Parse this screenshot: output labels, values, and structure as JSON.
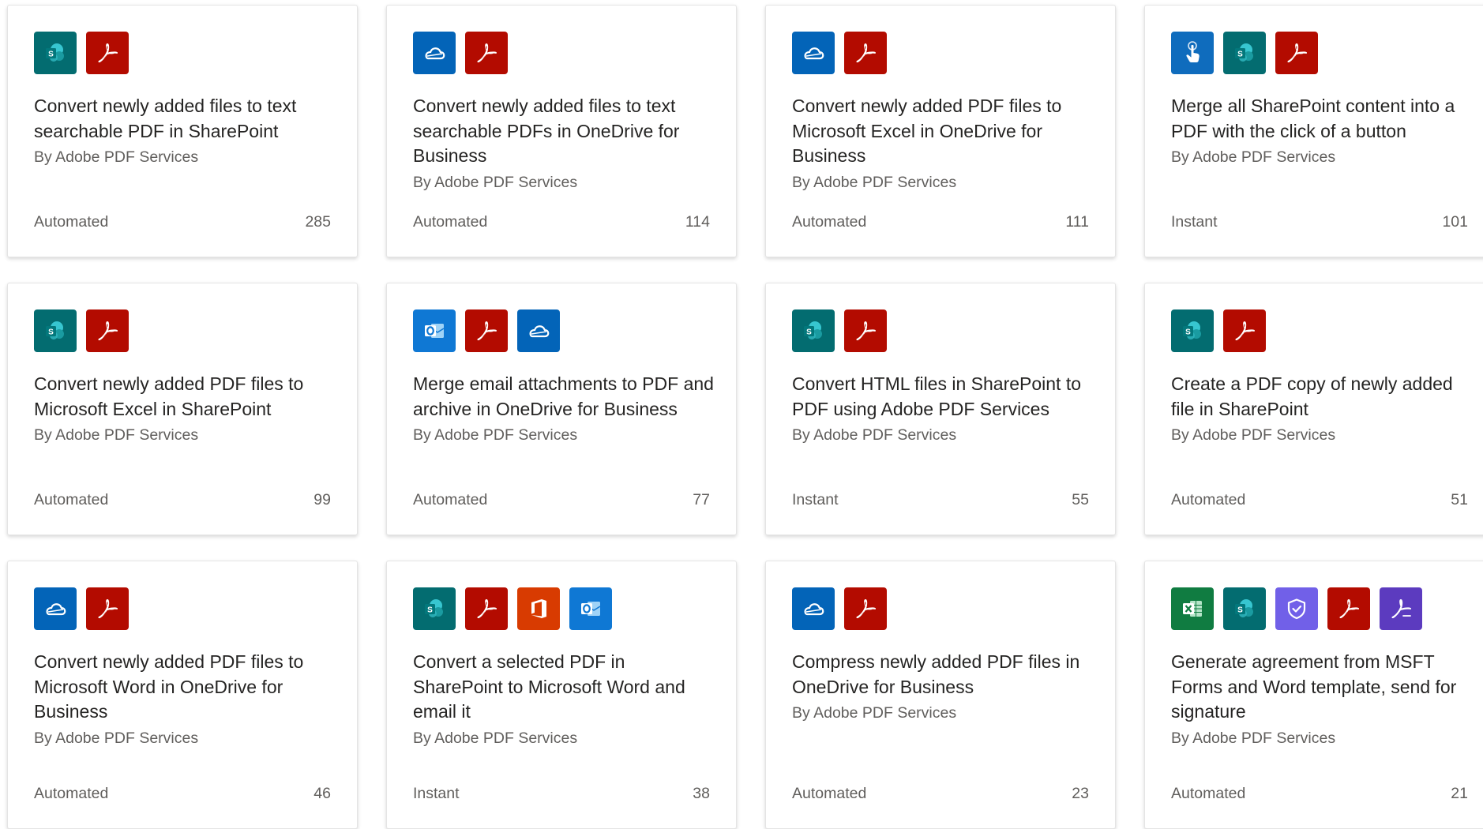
{
  "icon_colors": {
    "sharepoint": "#036c70",
    "acrobat": "#b30b00",
    "onedrive": "#0364b8",
    "button": "#0f6cbd",
    "outlook": "#0f78d4",
    "office": "#d83b01",
    "excel": "#107c41",
    "forms": "#7160e8",
    "acrobat_sign": "#5c3bbf"
  },
  "cards": [
    {
      "icons": [
        "sharepoint-icon",
        "acrobat-icon"
      ],
      "title": "Convert newly added files to text searchable PDF in SharePoint",
      "author": "By Adobe PDF Services",
      "type": "Automated",
      "count": "285"
    },
    {
      "icons": [
        "onedrive-icon",
        "acrobat-icon"
      ],
      "title": "Convert newly added files to text searchable PDFs in OneDrive for Business",
      "author": "By Adobe PDF Services",
      "type": "Automated",
      "count": "114"
    },
    {
      "icons": [
        "onedrive-icon",
        "acrobat-icon"
      ],
      "title": "Convert newly added PDF files to Microsoft Excel in OneDrive for Business",
      "author": "By Adobe PDF Services",
      "type": "Automated",
      "count": "111"
    },
    {
      "icons": [
        "button-icon",
        "sharepoint-icon",
        "acrobat-icon"
      ],
      "title": "Merge all SharePoint content into a PDF with the click of a button",
      "author": "By Adobe PDF Services",
      "type": "Instant",
      "count": "101"
    },
    {
      "icons": [
        "sharepoint-icon",
        "acrobat-icon"
      ],
      "title": "Convert newly added PDF files to Microsoft Excel in SharePoint",
      "author": "By Adobe PDF Services",
      "type": "Automated",
      "count": "99"
    },
    {
      "icons": [
        "outlook-icon",
        "acrobat-icon",
        "onedrive-icon"
      ],
      "title": "Merge email attachments to PDF and archive in OneDrive for Business",
      "author": "By Adobe PDF Services",
      "type": "Automated",
      "count": "77"
    },
    {
      "icons": [
        "sharepoint-icon",
        "acrobat-icon"
      ],
      "title": "Convert HTML files in SharePoint to PDF using Adobe PDF Services",
      "author": "By Adobe PDF Services",
      "type": "Instant",
      "count": "55"
    },
    {
      "icons": [
        "sharepoint-icon",
        "acrobat-icon"
      ],
      "title": "Create a PDF copy of newly added file in SharePoint",
      "author": "By Adobe PDF Services",
      "type": "Automated",
      "count": "51"
    },
    {
      "icons": [
        "onedrive-icon",
        "acrobat-icon"
      ],
      "title": "Convert newly added PDF files to Microsoft Word in OneDrive for Business",
      "author": "By Adobe PDF Services",
      "type": "Automated",
      "count": "46"
    },
    {
      "icons": [
        "sharepoint-icon",
        "acrobat-icon",
        "office-icon",
        "outlook-icon"
      ],
      "title": "Convert a selected PDF in SharePoint to Microsoft Word and email it",
      "author": "By Adobe PDF Services",
      "type": "Instant",
      "count": "38"
    },
    {
      "icons": [
        "onedrive-icon",
        "acrobat-icon"
      ],
      "title": "Compress newly added PDF files in OneDrive for Business",
      "author": "By Adobe PDF Services",
      "type": "Automated",
      "count": "23"
    },
    {
      "icons": [
        "excel-icon",
        "sharepoint-icon",
        "forms-icon",
        "acrobat-icon",
        "acrobat-sign-icon"
      ],
      "title": "Generate agreement from MSFT Forms and Word template, send for signature",
      "author": "By Adobe PDF Services",
      "type": "Automated",
      "count": "21"
    }
  ]
}
